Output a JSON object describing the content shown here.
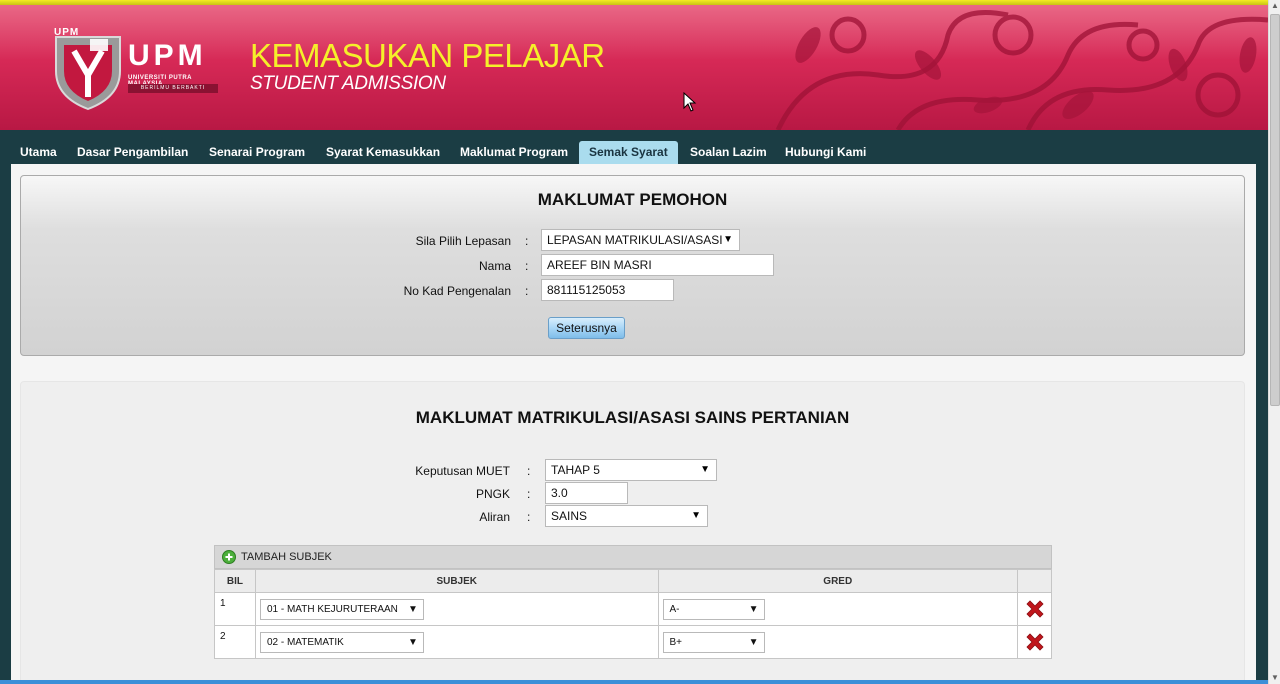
{
  "header": {
    "logo_small": "UPM",
    "logo_letters": "UPM",
    "logo_university": "UNIVERSITI PUTRA MALAYSIA",
    "logo_motto": "BERILMU BERBAKTI",
    "title_main": "KEMASUKAN PELAJAR",
    "title_sub": "STUDENT ADMISSION"
  },
  "nav": {
    "tabs": [
      {
        "label": "Utama"
      },
      {
        "label": "Dasar Pengambilan"
      },
      {
        "label": "Senarai Program"
      },
      {
        "label": "Syarat Kemasukkan"
      },
      {
        "label": "Maklumat Program"
      },
      {
        "label": "Semak Syarat"
      },
      {
        "label": "Soalan Lazim"
      },
      {
        "label": "Hubungi Kami"
      }
    ],
    "active": "Semak Syarat"
  },
  "applicant": {
    "title": "MAKLUMAT PEMOHON",
    "colon": ":",
    "lepasan_label": "Sila Pilih Lepasan",
    "lepasan_value": "LEPASAN MATRIKULASI/ASASI",
    "nama_label": "Nama",
    "nama_value": "AREEF BIN MASRI",
    "ic_label": "No Kad Pengenalan",
    "ic_value": "881115125053",
    "next_button": "Seterusnya"
  },
  "matrik": {
    "title": "MAKLUMAT MATRIKULASI/ASASI SAINS PERTANIAN",
    "muet_label": "Keputusan MUET",
    "muet_value": "TAHAP 5",
    "pngk_label": "PNGK",
    "pngk_value": "3.0",
    "aliran_label": "Aliran",
    "aliran_value": "SAINS"
  },
  "subjects": {
    "add_label": "TAMBAH SUBJEK",
    "headers": {
      "bil": "BIL",
      "subjek": "SUBJEK",
      "gred": "GRED"
    },
    "rows": [
      {
        "bil": "1",
        "subjek": "01 - MATH KEJURUTERAAN",
        "gred": "A-"
      },
      {
        "bil": "2",
        "subjek": "02 - MATEMATIK",
        "gred": "B+"
      }
    ]
  },
  "icons": {
    "dropdown": "▼",
    "scroll_up": "▲",
    "scroll_down": "▼",
    "add": "add-circle-icon",
    "delete": "delete-x-icon"
  },
  "colors": {
    "banner": "#d62956",
    "title_yellow": "#f5f02a",
    "nav_bg": "#1b3d44",
    "active_tab": "#aadcee",
    "delete_red": "#c0161c",
    "add_green": "#4caf3b"
  }
}
